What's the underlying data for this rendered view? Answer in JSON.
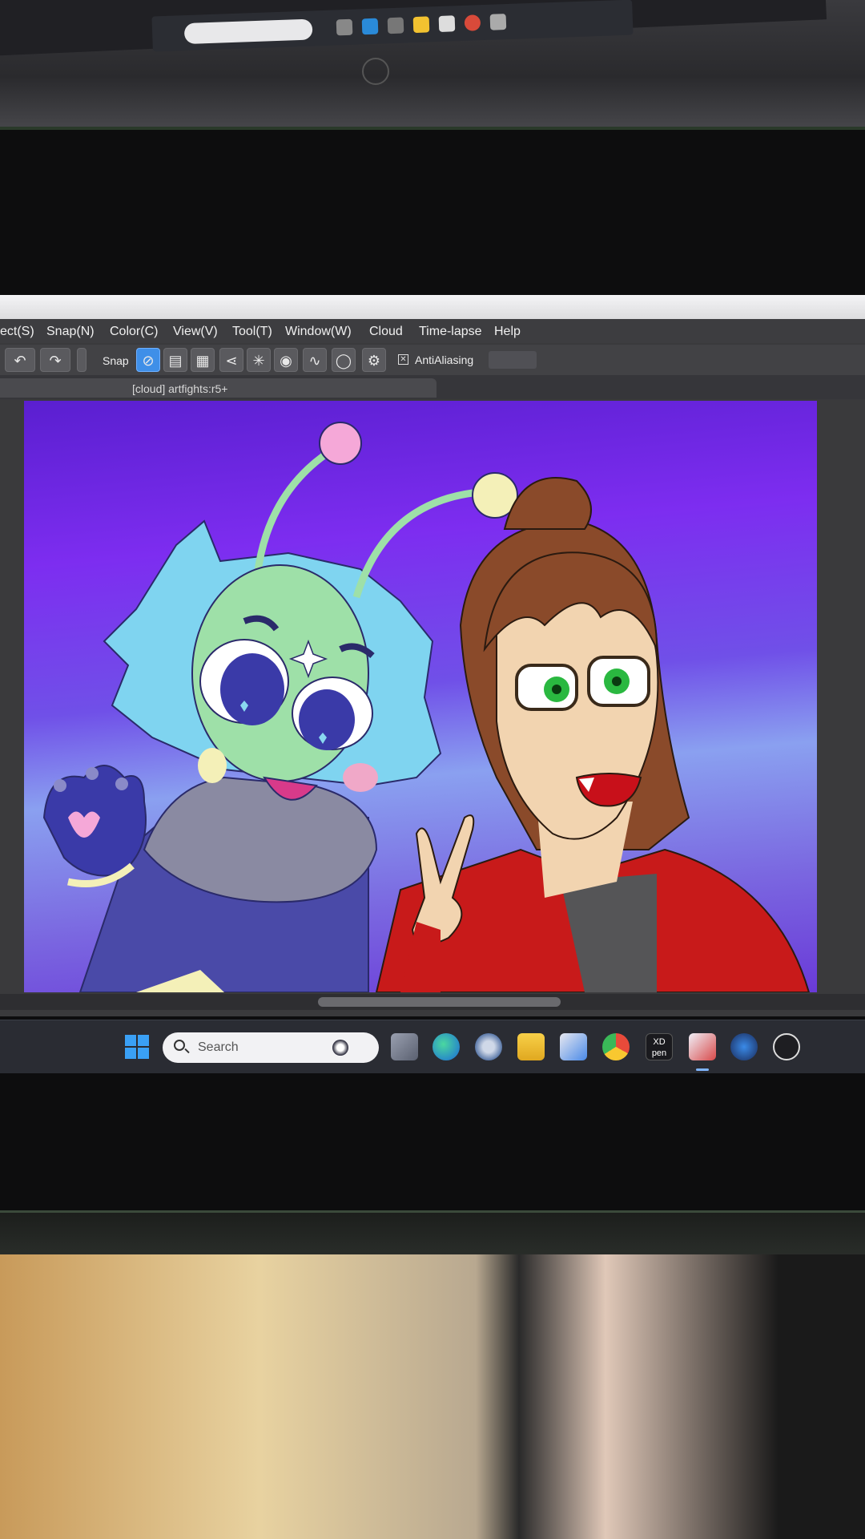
{
  "app": {
    "menu": [
      "ect(S)",
      "Snap(N)",
      "Color(C)",
      "View(V)",
      "Tool(T)",
      "Window(W)",
      "Cloud",
      "Time-lapse",
      "Help"
    ],
    "toolbar": {
      "snap_label": "Snap",
      "antialiasing_label": "AntiAliasing",
      "antialiasing_checked": true
    },
    "document_tab": "[cloud] artfights:r5+"
  },
  "taskbar": {
    "search_placeholder": "Search",
    "apps": [
      "task-view",
      "edge",
      "settings",
      "file-explorer",
      "store",
      "chrome",
      "xp-pen",
      "medibang",
      "steam",
      "obs"
    ],
    "xp_pen_label": "XD pen"
  },
  "colors": {
    "accent": "#3f8fe8",
    "canvas_top": "#5a1fd0",
    "canvas_mid": "#8aa0f0"
  }
}
